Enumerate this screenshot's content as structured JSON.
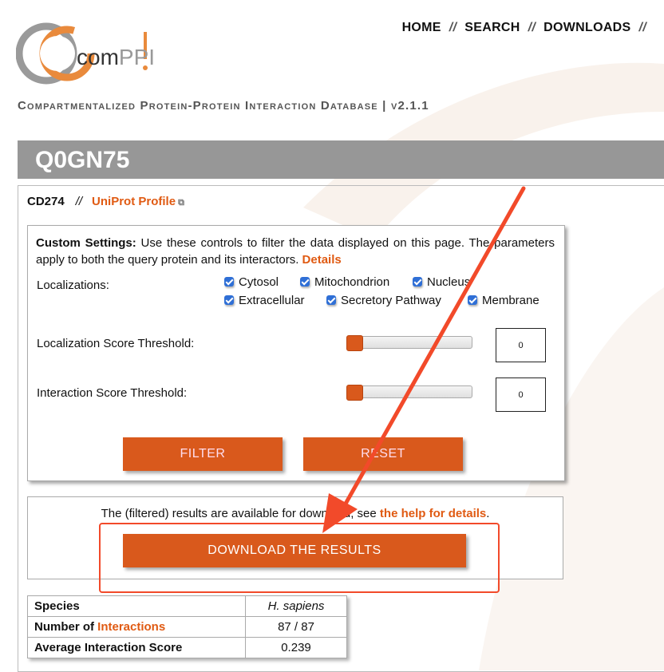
{
  "logo": {
    "prefix": "com",
    "suffix": "PPI"
  },
  "nav": {
    "items": [
      "HOME",
      "SEARCH",
      "DOWNLOADS"
    ],
    "separator": "//"
  },
  "tagline": "Compartmentalized Protein-Protein Interaction Database | v2.1.1",
  "page_title": "Q0GN75",
  "protein": {
    "gene": "CD274",
    "separator": "//",
    "uniprot_link": "UniProt Profile"
  },
  "settings": {
    "intro_bold": "Custom Settings:",
    "intro_text": " Use these controls to filter the data displayed on this page. The parameters apply to both the query protein and its interactors. ",
    "details_link": "Details",
    "localizations_label": "Localizations:",
    "localizations": [
      {
        "label": "Cytosol",
        "checked": true
      },
      {
        "label": "Mitochondrion",
        "checked": true
      },
      {
        "label": "Nucleus",
        "checked": true
      },
      {
        "label": "Extracellular",
        "checked": true
      },
      {
        "label": "Secretory Pathway",
        "checked": true
      },
      {
        "label": "Membrane",
        "checked": true
      }
    ],
    "loc_threshold_label": "Localization Score Threshold:",
    "loc_threshold_value": "0",
    "int_threshold_label": "Interaction Score Threshold:",
    "int_threshold_value": "0",
    "filter_button": "FILTER",
    "reset_button": "RESET"
  },
  "download": {
    "text": "The (filtered) results are available for download, see ",
    "help_link": "the help for details",
    "text_end": ".",
    "button": "DOWNLOAD THE RESULTS"
  },
  "stats": {
    "species_label": "Species",
    "species_value": "H. sapiens",
    "interactions_label_prefix": "Number of ",
    "interactions_label_link": "Interactions",
    "interactions_value": "87 / 87",
    "avg_score_label": "Average Interaction Score",
    "avg_score_value": "0.239"
  },
  "colors": {
    "accent": "#d9591c",
    "link": "#e05a12",
    "title_bar": "#979797",
    "annotation": "#f24a2a"
  }
}
